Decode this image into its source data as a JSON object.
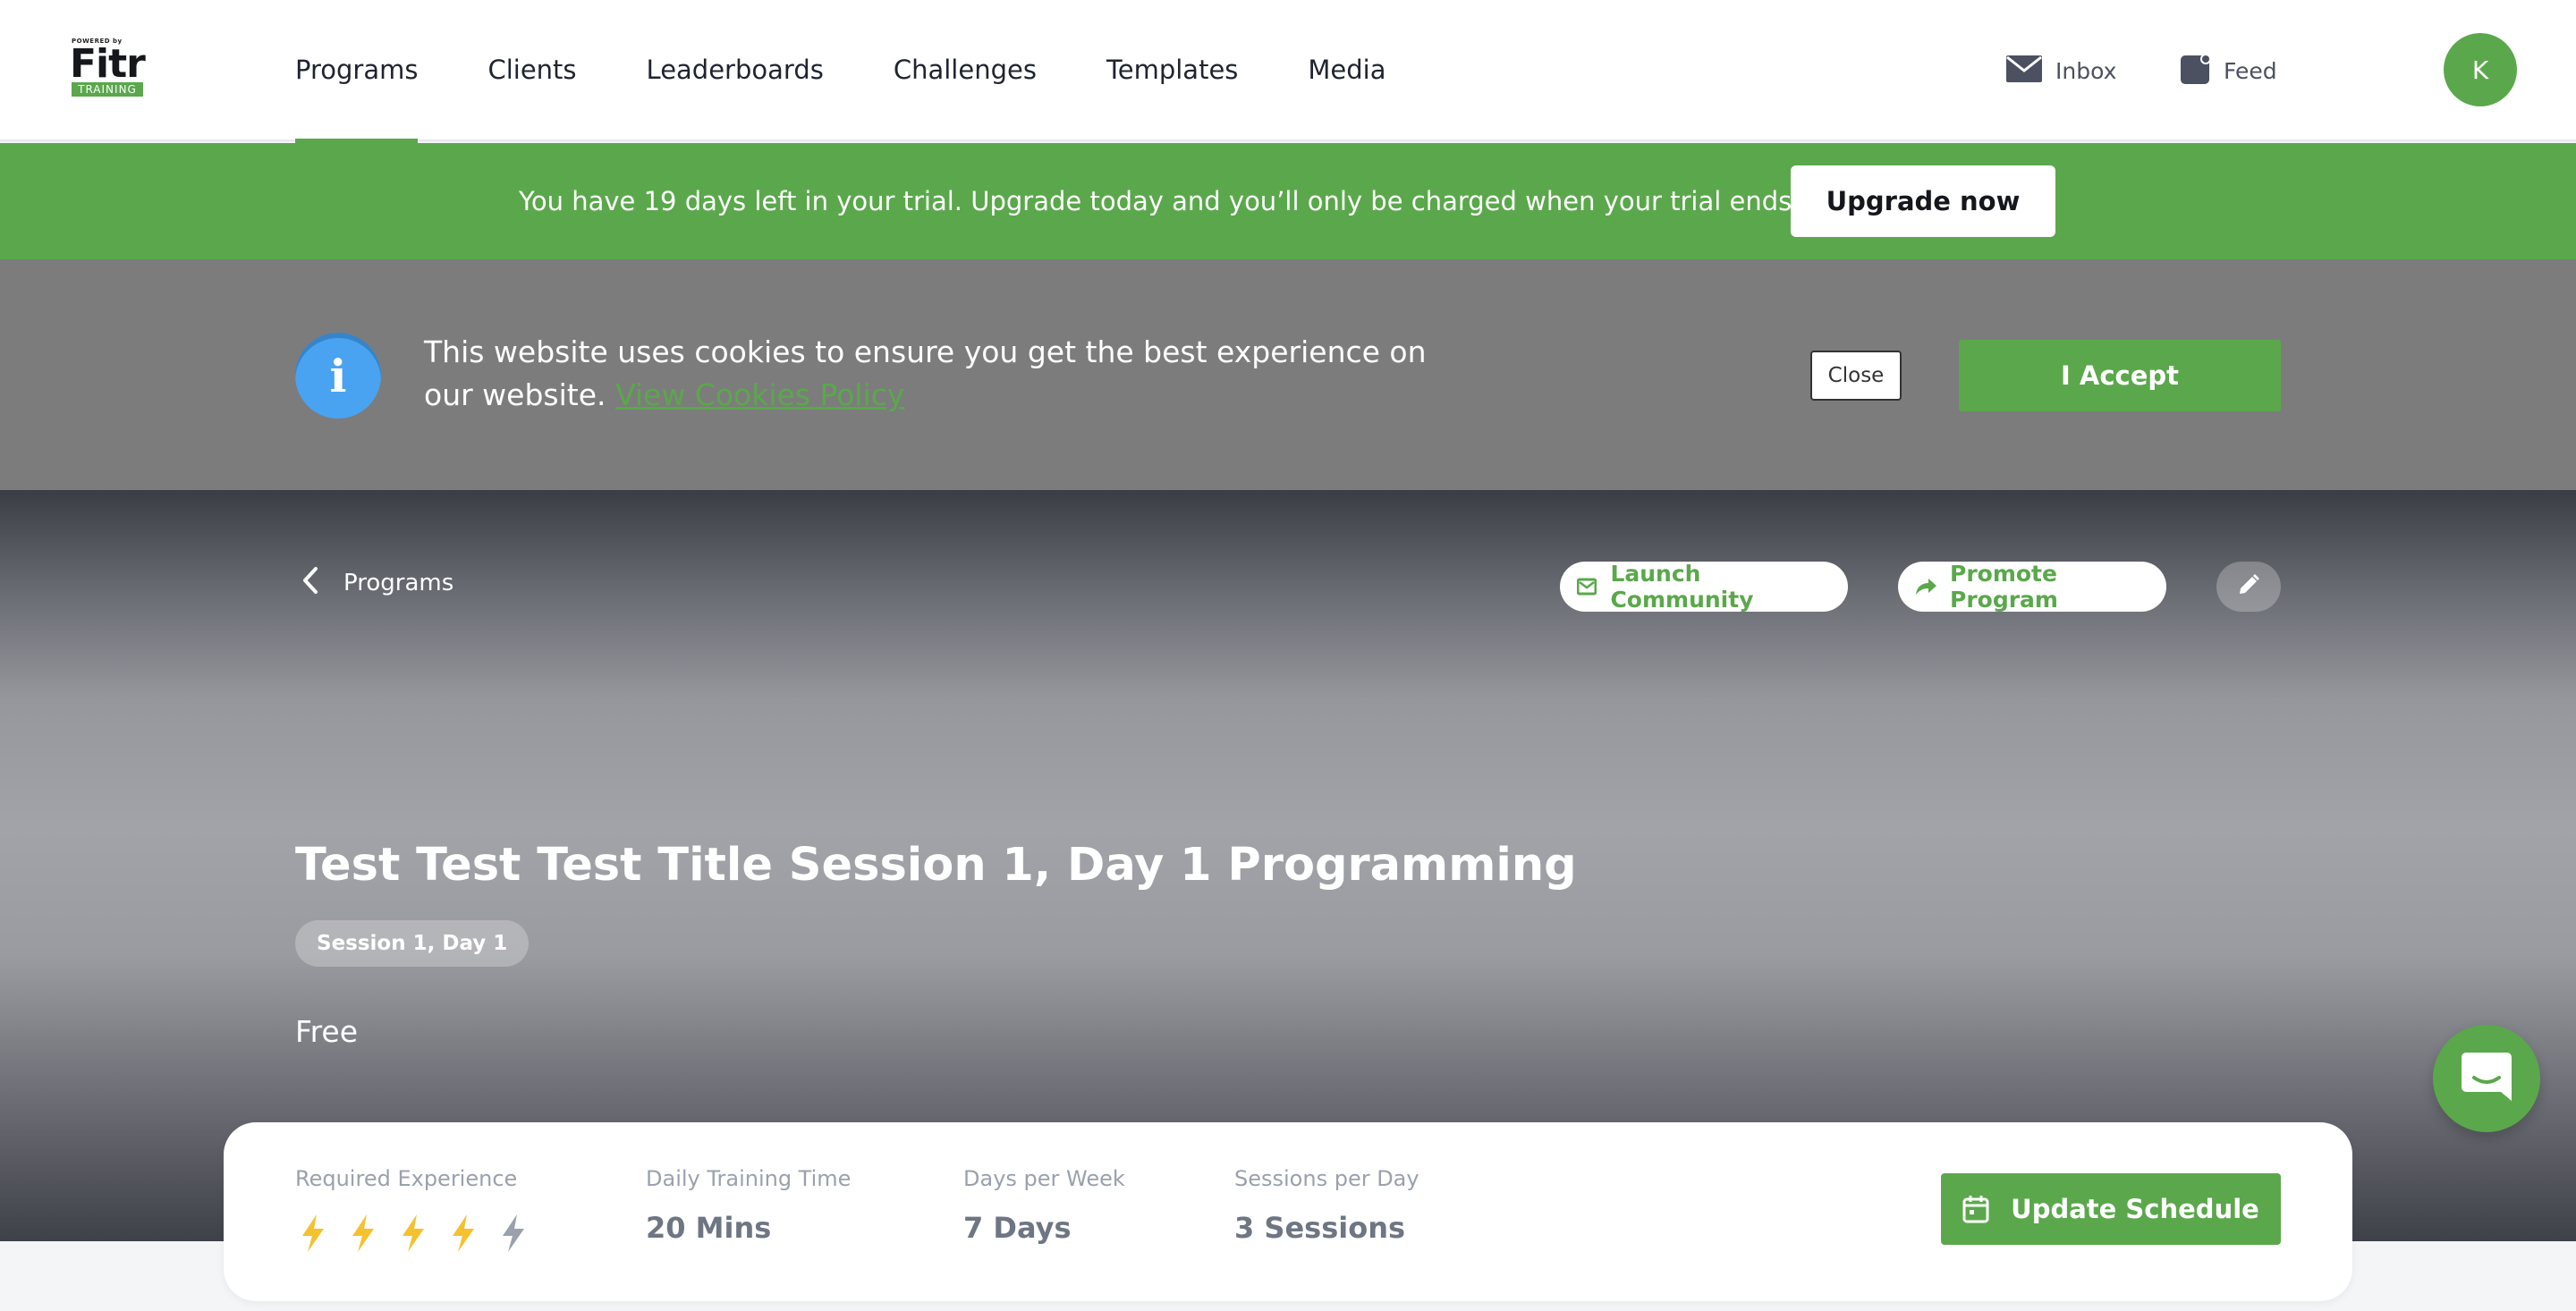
{
  "logo": {
    "powered": "POWERED by",
    "brand": "Fitr",
    "tag": "TRAINING"
  },
  "nav": {
    "items": [
      {
        "label": "Programs",
        "active": true
      },
      {
        "label": "Clients"
      },
      {
        "label": "Leaderboards"
      },
      {
        "label": "Challenges"
      },
      {
        "label": "Templates"
      },
      {
        "label": "Media"
      }
    ],
    "inbox_label": "Inbox",
    "feed_label": "Feed",
    "avatar_initial": "K"
  },
  "trial": {
    "text": "You have 19 days left in your trial. Upgrade today and you’ll only be charged when your trial ends.",
    "button": "Upgrade now"
  },
  "cookie": {
    "text": "This website uses cookies to ensure you get the best experience on our website.",
    "link": "View Cookies Policy",
    "close": "Close",
    "accept": "I Accept"
  },
  "program": {
    "back_label": "Programs",
    "launch_label": "Launch Community",
    "promote_label": "Promote Program",
    "title": "Test Test Test Title Session 1, Day 1 Programming",
    "session_pill": "Session 1, Day 1",
    "price": "Free"
  },
  "stats": {
    "experience_label": "Required Experience",
    "experience_level": 4,
    "experience_max": 5,
    "training_time_label": "Daily Training Time",
    "training_time": "20 Mins",
    "days_label": "Days per Week",
    "days": "7 Days",
    "sessions_label": "Sessions per Day",
    "sessions": "3 Sessions",
    "update_button": "Update Schedule"
  },
  "colors": {
    "accent": "#5aa84b",
    "bolt_active": "#f5c12e",
    "bolt_inactive": "#9aa1ad",
    "info": "#4aa3f0"
  },
  "icons": [
    "envelope-icon",
    "feed-icon",
    "info-icon",
    "chevron-left-icon",
    "mail-icon",
    "share-arrow-icon",
    "pencil-icon",
    "bolt-icon",
    "calendar-icon",
    "chat-icon"
  ]
}
